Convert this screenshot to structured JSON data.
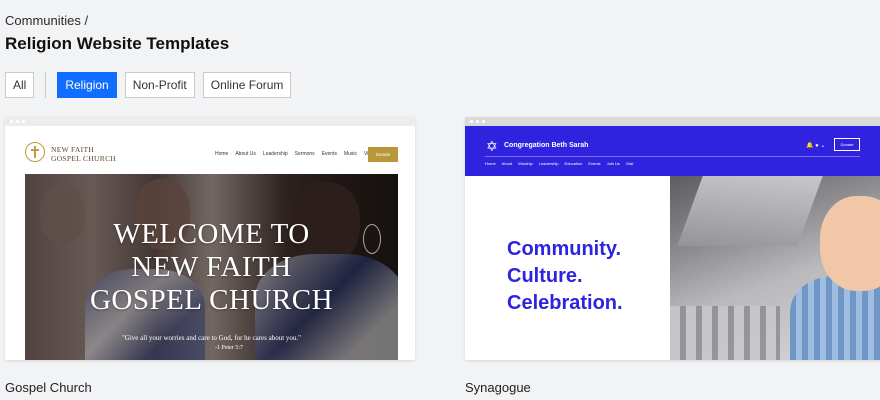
{
  "breadcrumb": "Communities /",
  "page_title": "Religion Website Templates",
  "filters": [
    {
      "label": "All",
      "active": false
    },
    {
      "label": "Religion",
      "active": true
    },
    {
      "label": "Non-Profit",
      "active": false
    },
    {
      "label": "Online Forum",
      "active": false
    }
  ],
  "colors": {
    "accent": "#116dff",
    "synagogue_blue": "#2f23e0",
    "gold": "#b8963a"
  },
  "templates": [
    {
      "caption": "Gospel Church",
      "preview": {
        "logo_line1": "NEW FAITH",
        "logo_line2": "GOSPEL CHURCH",
        "nav": [
          "Home",
          "About Us",
          "Leadership",
          "Sermons",
          "Events",
          "Music",
          "Visit"
        ],
        "button": "Donate",
        "hero_line1": "WELCOME TO",
        "hero_line2": "NEW FAITH",
        "hero_line3": "GOSPEL CHURCH",
        "quote": "\"Give all your worries and care to God, for he cares about you.\"",
        "cite": "-1 Peter 5:7"
      }
    },
    {
      "caption": "Synagogue",
      "preview": {
        "brand": "Congregation Beth Sarah",
        "nav": [
          "Home",
          "About",
          "Worship",
          "Leadership",
          "Education",
          "Events",
          "Join Us",
          "Visit"
        ],
        "button": "Donate",
        "icons": "🔔 ● ⌄",
        "headline1": "Community.",
        "headline2": "Culture.",
        "headline3": "Celebration."
      }
    }
  ]
}
